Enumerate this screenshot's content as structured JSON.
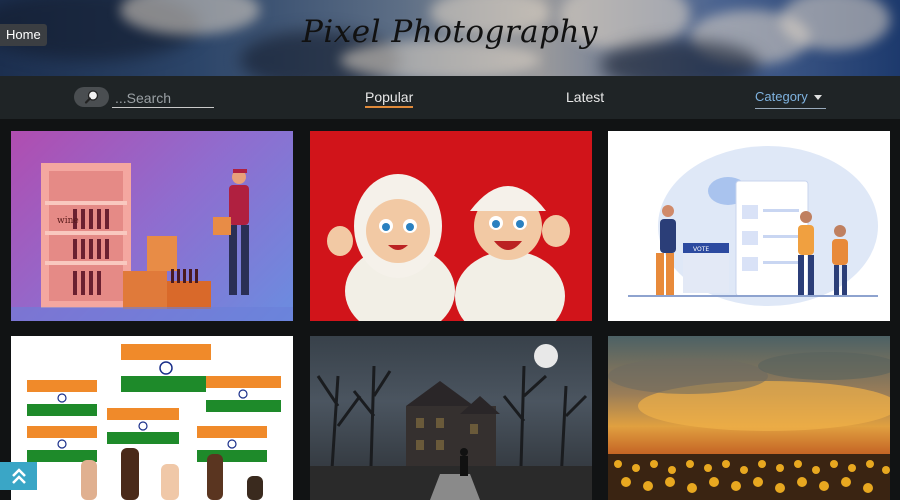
{
  "header": {
    "home_label": "Home",
    "site_title": "Pixel Photography"
  },
  "nav": {
    "search_placeholder": "...Search",
    "search_icon": "search-icon",
    "tabs": [
      {
        "label": "Popular",
        "active": true
      },
      {
        "label": "Latest",
        "active": false
      }
    ],
    "category_label": "Category"
  },
  "gallery": {
    "items": [
      {
        "subject": "wine shop delivery illustration",
        "text": "wine"
      },
      {
        "subject": "cartoon kids waving on red background"
      },
      {
        "subject": "voting illustration",
        "text": "VOTE"
      },
      {
        "subject": "hands waving indian flags"
      },
      {
        "subject": "haunted house at night with full moon"
      },
      {
        "subject": "sunset over sunflower field"
      }
    ]
  },
  "scroll_top_icon": "double-chevron-up-icon",
  "colors": {
    "nav_bg": "#1f2426",
    "page_bg": "#111314",
    "active_tab_underline": "#e08a3a",
    "category_text": "#7fb3e0",
    "scroll_top_bg": "#3aa6c6"
  }
}
